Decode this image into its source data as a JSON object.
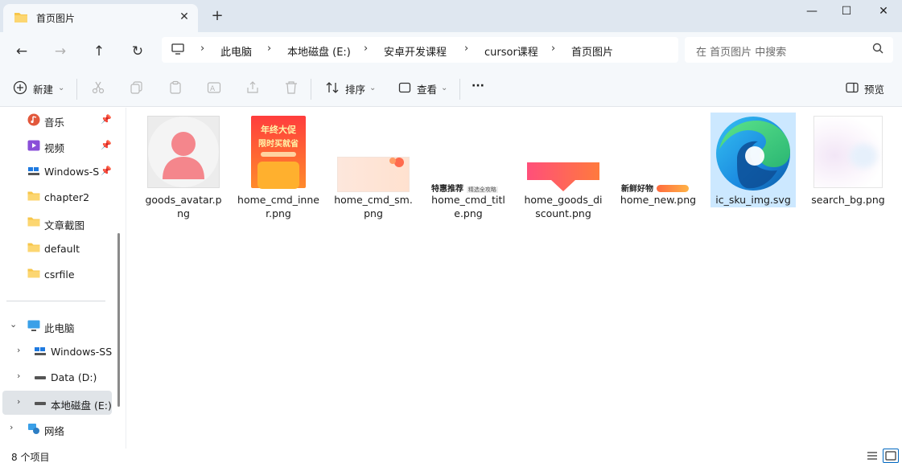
{
  "tab": {
    "title": "首页图片",
    "close": "✕",
    "new_tab": "+"
  },
  "window": {
    "minimize": "—",
    "maximize": "☐",
    "close": "✕"
  },
  "nav": {
    "back": "←",
    "forward": "→",
    "up": "↑",
    "refresh": "↻"
  },
  "breadcrumb": [
    "此电脑",
    "本地磁盘 (E:)",
    "安卓开发课程",
    "cursor课程",
    "首页图片"
  ],
  "search": {
    "placeholder": "在 首页图片 中搜索"
  },
  "toolbar": {
    "new_label": "新建",
    "sort_label": "排序",
    "view_label": "查看",
    "more_label": "···",
    "preview_label": "预览"
  },
  "sidebar": {
    "quick": [
      {
        "label": "音乐",
        "icon": "music-icon"
      },
      {
        "label": "视频",
        "icon": "video-icon"
      },
      {
        "label": "Windows-SSD",
        "icon": "drive-icon"
      },
      {
        "label": "chapter2",
        "icon": "folder-icon"
      },
      {
        "label": "文章截图",
        "icon": "folder-icon"
      },
      {
        "label": "default",
        "icon": "folder-icon"
      },
      {
        "label": "csrfile",
        "icon": "folder-icon"
      }
    ],
    "this_pc": "此电脑",
    "drives": [
      "Windows-SSD",
      "Data (D:)",
      "本地磁盘 (E:)"
    ],
    "network": "网络"
  },
  "files": [
    {
      "name": "goods_avatar.png"
    },
    {
      "name": "home_cmd_inner.png",
      "text1": "年终大促",
      "text2": "限时买就省"
    },
    {
      "name": "home_cmd_sm.png"
    },
    {
      "name": "home_cmd_title.png",
      "text1": "特惠推荐",
      "text2": "精选全攻略"
    },
    {
      "name": "home_goods_discount.png"
    },
    {
      "name": "home_new.png",
      "text1": "新鲜好物"
    },
    {
      "name": "ic_sku_img.svg"
    },
    {
      "name": "search_bg.png"
    }
  ],
  "status": {
    "count": "8 个项目"
  },
  "colors": {
    "titlebar": "#dfe7f0",
    "selected": "#cce8ff",
    "folder": "#f7c64a",
    "accent": "#0067c0"
  }
}
